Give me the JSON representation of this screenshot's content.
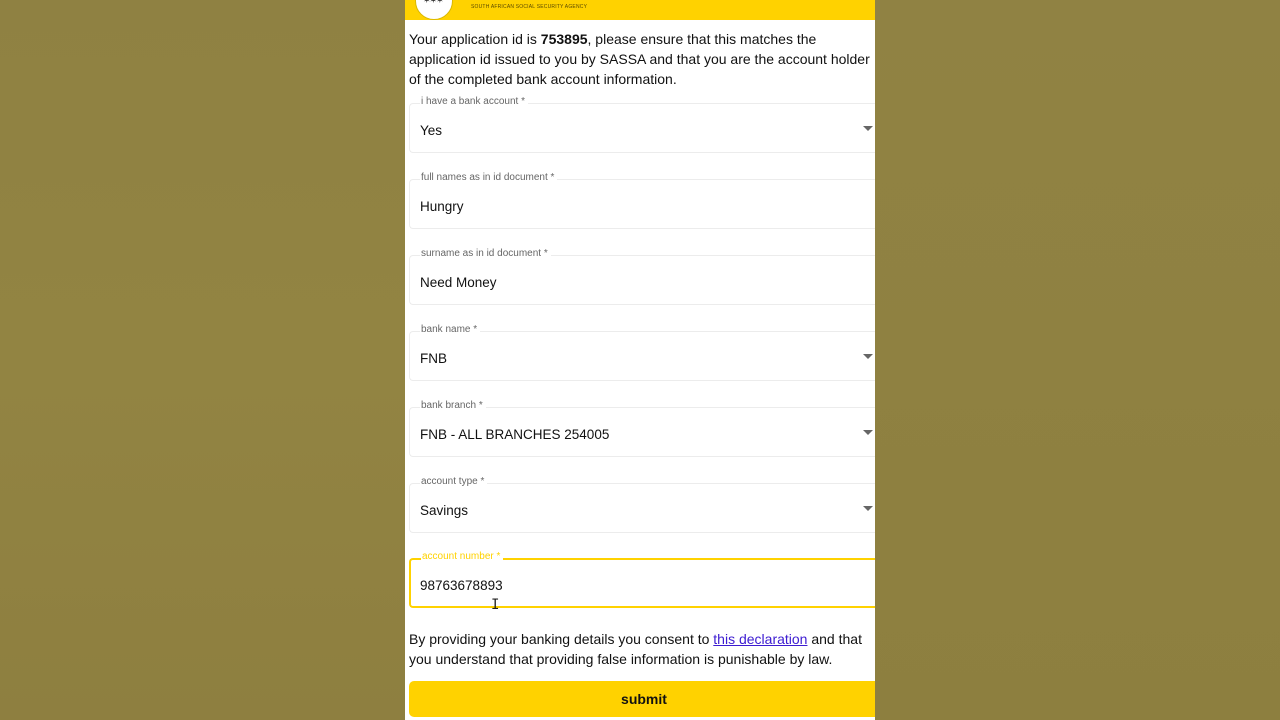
{
  "header": {
    "agency_name": "SOUTH AFRICAN SOCIAL SECURITY AGENCY",
    "logo_icon": "sassa-logo"
  },
  "intro": {
    "part1": "Your application id is ",
    "application_id": "753895",
    "part2": ", please ensure that this matches the application id issued to you by SASSA and that you are the account holder of the completed bank account information."
  },
  "form": {
    "has_bank_account": {
      "label": "i have a bank account *",
      "value": "Yes"
    },
    "full_names": {
      "label": "full names as in id document *",
      "value": "Hungry"
    },
    "surname": {
      "label": "surname as in id document *",
      "value": "Need Money"
    },
    "bank_name": {
      "label": "bank name *",
      "value": "FNB"
    },
    "bank_branch": {
      "label": "bank branch *",
      "value": "FNB - ALL BRANCHES 254005"
    },
    "account_type": {
      "label": "account type *",
      "value": "Savings"
    },
    "account_number": {
      "label": "account number *",
      "value": "98763678893"
    }
  },
  "consent": {
    "part1": "By providing your banking details you consent to ",
    "link": "this declaration",
    "part2": " and that you understand that providing false information is punishable by law."
  },
  "submit_label": "submit",
  "colors": {
    "accent": "#ffd200",
    "backdrop": "#908241",
    "link": "#3c1bd1"
  }
}
